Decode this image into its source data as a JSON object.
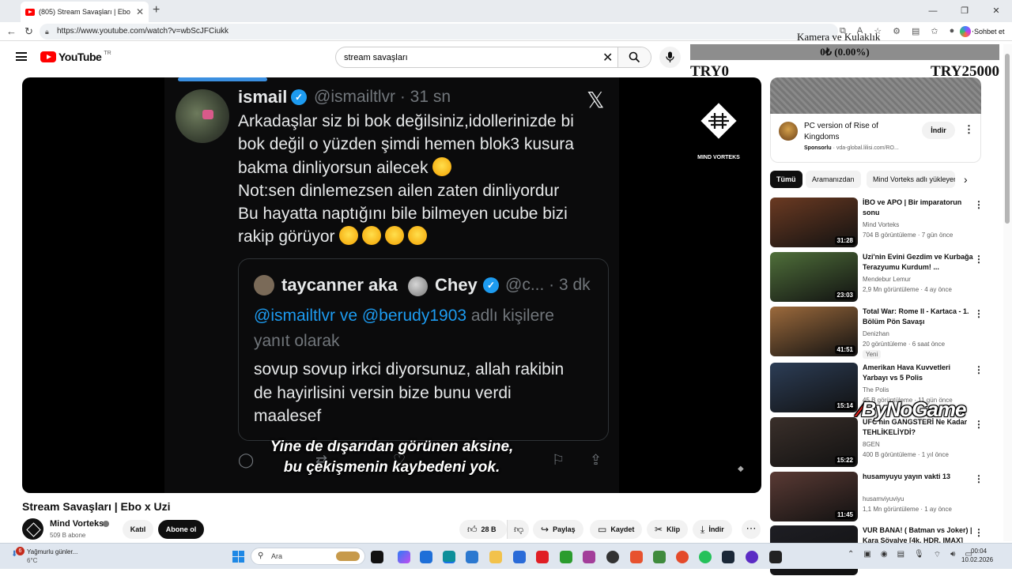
{
  "browser": {
    "tab_title": "(805) Stream Savaşları | Ebo x Uzi",
    "url": "https://www.youtube.com/watch?v=wbScJFCiukk",
    "chat_label": "Sohbet et"
  },
  "header": {
    "logo": "YouTube",
    "country": "TR",
    "search_query": "stream savaşları"
  },
  "widget": {
    "title": "Kamera ve Kulaklık",
    "percent": "0₺ (0.00%)",
    "min_label": "TRY0",
    "max_label": "TRY25000",
    "progress": 0
  },
  "video": {
    "tweet": {
      "name": "ismail",
      "handle_time": "@ismailtlvr · 31 sn",
      "lines": [
        "Arkadaşlar siz bi bok değilsiniz,idollerinizde bi",
        "bok değil o yüzden şimdi hemen blok3 kusura",
        "bakma dinliyorsun ailecek",
        "Not:sen dinlemezsen ailen zaten dinliyordur",
        "Bu hayatta naptığını bile bilmeyen ucube bizi",
        "rakip görüyor"
      ],
      "quote": {
        "name": "taycanner aka",
        "name2": "Chey",
        "handle_time": "@c... · 3 dk",
        "reply_mentions": "@ismailtlvr ve @berudy1903",
        "reply_suffix": " adlı kişilere",
        "reply_line2": "yanıt olarak",
        "body": [
          "sovup sovup irkci diyorsunuz, allah rakibin",
          "de hayirlisini versin bize bunu verdi",
          "maalesef"
        ]
      }
    },
    "subtitle": [
      "Yine de dışarıdan görünen aksine,",
      "bu çekişmenin kaybedeni yok."
    ],
    "watermark": "MIND VORTEKS"
  },
  "below": {
    "title": "Stream Savaşları | Ebo x Uzi",
    "channel": "Mind Vorteks",
    "subscribers": "509 B abone",
    "join": "Katıl",
    "subscribe": "Abone ol",
    "likes": "28 B",
    "share": "Paylaş",
    "save": "Kaydet",
    "clip": "Klip",
    "download": "İndir"
  },
  "ad": {
    "title": "PC version of Rise of Kingdoms",
    "sponsored": "Sponsorlu",
    "domain": "vda-global.lilisi.com/RO...",
    "install": "İndir"
  },
  "chips": [
    "Tümü",
    "Aramanızdan",
    "Mind Vorteks adlı yükleyen"
  ],
  "recommendations": [
    {
      "title": "İBO ve APO | Bir imparatorun sonu",
      "channel": "Mind Vorteks",
      "meta": "704 B görüntüleme · 7 gün önce",
      "duration": "31:28",
      "color": "#6b3a22"
    },
    {
      "title": "Uzi'nin Evini Gezdim ve Kurbağa Terazyumu Kurdum! ...",
      "channel": "Mendebur Lemur",
      "meta": "2,9 Mn görüntüleme · 4 ay önce",
      "duration": "23:03",
      "color": "#4f6f3a"
    },
    {
      "title": "Total War: Rome II - Kartaca - 1. Bölüm Pön Savaşı",
      "channel": "Denizhan",
      "meta": "20 görüntüleme · 6 saat önce",
      "duration": "41:51",
      "color": "#9c6a3c",
      "badge": "Yeni"
    },
    {
      "title": "Amerikan Hava Kuvvetleri Yarbayı vs 5 Polis",
      "channel": "The Polis",
      "meta": "45 B görüntüleme · 11 gün önce",
      "duration": "15:14",
      "color": "#2c3d56"
    },
    {
      "title": "UFC'nin GANGSTERİ Ne Kadar TEHLİKELİYDİ?",
      "channel": "8GEN",
      "meta": "400 B görüntüleme · 1 yıl önce",
      "duration": "15:22",
      "color": "#3a2f2a"
    },
    {
      "title": "husamyuyu yayın vakti 13",
      "channel": "husamviyuviyu",
      "meta": "1,1 Mn görüntüleme · 1 ay önce",
      "duration": "11:45",
      "color": "#5a3a34"
    },
    {
      "title": "VUR BANA! ( Batman vs Joker) | Kara Şövalye [4k, HDR, IMAX]",
      "channel": "",
      "meta": "",
      "duration": "",
      "color": "#1e1e24"
    }
  ],
  "overlay_logo": "ByNoGame",
  "taskbar": {
    "weather_badge": "6",
    "weather_text": "Yağmurlu günler...",
    "weather_temp": "6°C",
    "search_placeholder": "Ara",
    "time": "00:04",
    "date": "10.02.2026"
  }
}
